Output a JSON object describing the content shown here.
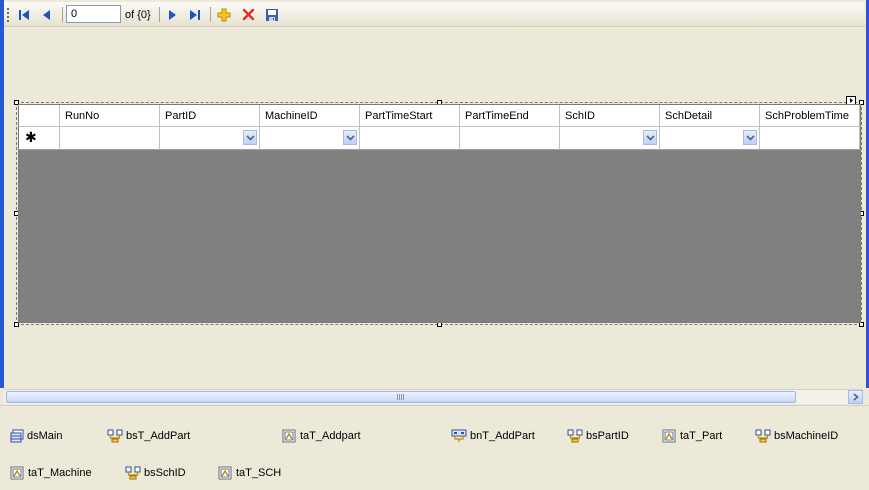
{
  "navigator": {
    "position": "0",
    "count_label": "of {0}",
    "buttons": {
      "move_first": "move-first-icon",
      "move_previous": "move-previous-icon",
      "move_next": "move-next-icon",
      "move_last": "move-last-icon",
      "add_new": "add-new-icon",
      "delete": "delete-icon",
      "save": "save-icon"
    }
  },
  "grid": {
    "columns": [
      "RunNo",
      "PartID",
      "MachineID",
      "PartTimeStart",
      "PartTimeEnd",
      "SchID",
      "SchDetail",
      "SchProblemTime"
    ],
    "new_row_marker": "✱",
    "combo_columns": [
      "PartID",
      "MachineID",
      "SchID",
      "SchDetail"
    ]
  },
  "tray": {
    "components": [
      {
        "name": "dsMain",
        "icon": "dataset-icon"
      },
      {
        "name": "bsT_AddPart",
        "icon": "binding-source-icon"
      },
      {
        "name": "taT_Addpart",
        "icon": "table-adapter-icon"
      },
      {
        "name": "bnT_AddPart",
        "icon": "binding-navigator-icon"
      },
      {
        "name": "bsPartID",
        "icon": "binding-source-icon"
      },
      {
        "name": "taT_Part",
        "icon": "table-adapter-icon"
      },
      {
        "name": "bsMachineID",
        "icon": "binding-source-icon"
      },
      {
        "name": "taT_Machine",
        "icon": "table-adapter-icon"
      },
      {
        "name": "bsSchID",
        "icon": "binding-source-icon"
      },
      {
        "name": "taT_SCH",
        "icon": "table-adapter-icon"
      }
    ]
  },
  "colors": {
    "selection_border": "#2A55D3",
    "grid_background": "#808080",
    "tray_background": "#ECE9D8"
  }
}
